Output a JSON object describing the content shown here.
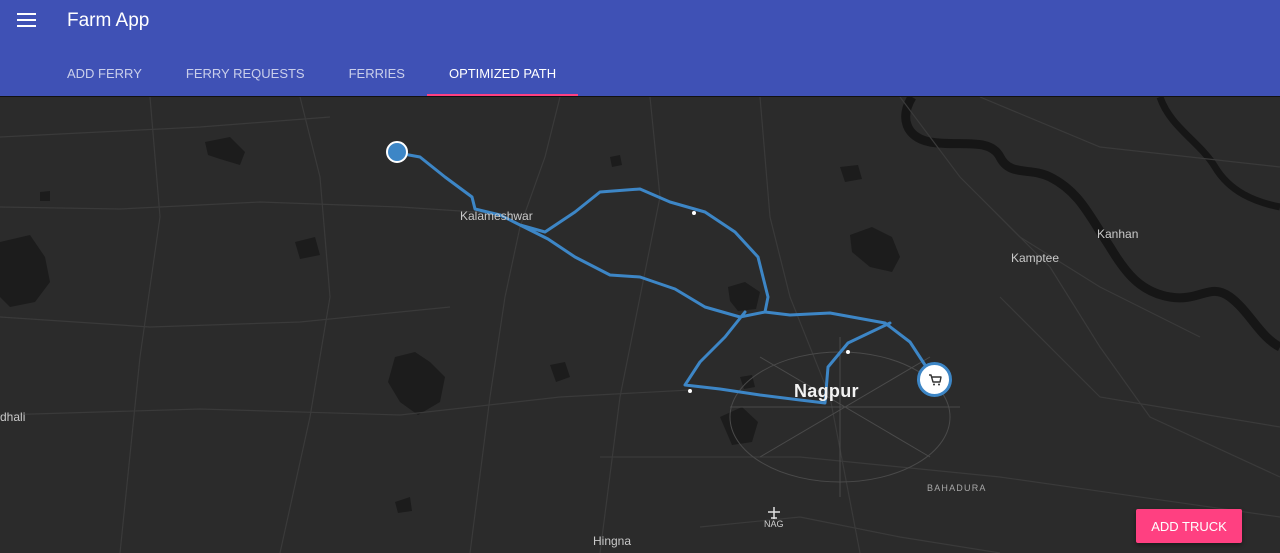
{
  "app": {
    "title": "Farm App",
    "menu_icon": "hamburger-menu-icon"
  },
  "tabs": [
    {
      "label": "ADD FERRY",
      "active": false
    },
    {
      "label": "FERRY REQUESTS",
      "active": false
    },
    {
      "label": "FERRIES",
      "active": false
    },
    {
      "label": "OPTIMIZED PATH",
      "active": true
    }
  ],
  "map": {
    "theme": "dark",
    "labels": {
      "kalameshwar": "Kalameshwar",
      "kanhan": "Kanhan",
      "kamptee": "Kamptee",
      "nagpur": "Nagpur",
      "bahadura": "BAHADURA",
      "nag": "NAG",
      "hingna": "Hingna",
      "dhali": "dhali"
    },
    "route_color": "#3d86c6",
    "origin_marker_icon": "location-dot-icon",
    "destination_marker_icon": "shopping-cart-icon"
  },
  "actions": {
    "add_truck": "ADD TRUCK"
  },
  "colors": {
    "appbar": "#3f51b5",
    "accent": "#ff4081",
    "map_bg": "#2b2b2b",
    "route": "#3d86c6"
  }
}
